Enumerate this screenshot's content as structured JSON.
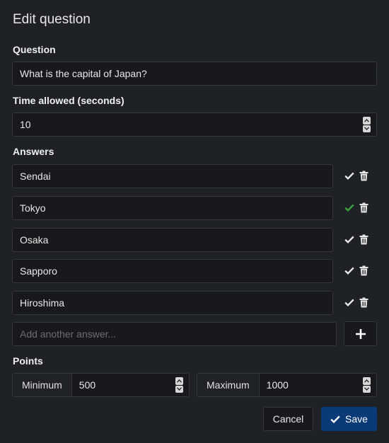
{
  "dialog": {
    "title": "Edit question"
  },
  "question": {
    "label": "Question",
    "value": "What is the capital of Japan?"
  },
  "time": {
    "label": "Time allowed (seconds)",
    "value": "10"
  },
  "answers": {
    "label": "Answers",
    "items": [
      {
        "text": "Sendai",
        "correct": false
      },
      {
        "text": "Tokyo",
        "correct": true
      },
      {
        "text": "Osaka",
        "correct": false
      },
      {
        "text": "Sapporo",
        "correct": false
      },
      {
        "text": "Hiroshima",
        "correct": false
      }
    ],
    "new_placeholder": "Add another answer..."
  },
  "points": {
    "label": "Points",
    "min_label": "Minimum",
    "min_value": "500",
    "max_label": "Maximum",
    "max_value": "1000"
  },
  "actions": {
    "cancel_label": "Cancel",
    "save_label": "Save"
  },
  "colors": {
    "correct": "#3fa33f",
    "check_default": "#e8e8e8",
    "save_bg": "#0b3a78"
  },
  "icons": {
    "mark_correct": "check-icon",
    "delete": "trash-icon",
    "add": "plus-icon",
    "save": "check-icon"
  }
}
